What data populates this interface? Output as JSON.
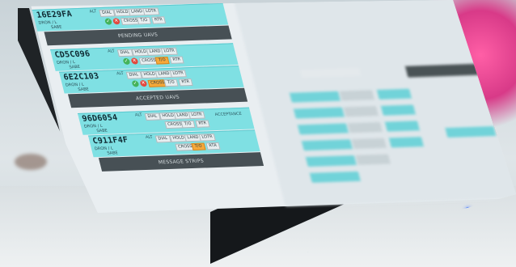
{
  "pending_strip": {
    "callsign": "16E29FA",
    "alt": "ALT",
    "line1": "DRON / L",
    "line2": "SABE",
    "buttons": [
      "DIAL",
      "HOLD",
      "LAND",
      "LOTR"
    ],
    "buttons2": [
      "CROSS",
      "T/O",
      "RTR"
    ]
  },
  "pending_label": "PENDING UAVS",
  "accepted": [
    {
      "callsign": "CD5C096",
      "alt": "ALT",
      "line1": "DRON / L",
      "line2": "SABE",
      "buttons": [
        "DIAL",
        "HOLD",
        "LAND",
        "LOTR"
      ],
      "buttons2": [
        "CROSS",
        "T/O",
        "RTR"
      ]
    },
    {
      "callsign": "6E2C103",
      "alt": "ALT",
      "line1": "DRON / L",
      "line2": "SABE",
      "buttons": [
        "DIAL",
        "HOLD",
        "LAND",
        "LOTR"
      ],
      "buttons2": [
        "CROSS",
        "T/O",
        "RTR"
      ]
    }
  ],
  "accepted_label": "ACCEPTED UAVS",
  "messages": [
    {
      "callsign": "96D6054",
      "alt": "ALT",
      "line1": "DRON / L",
      "line2": "SABE",
      "buttons": [
        "DIAL",
        "HOLD",
        "LAND",
        "LOTR"
      ],
      "buttons2": [
        "CROSS",
        "T/O",
        "RTR"
      ],
      "tag": "ACCEPTANCE"
    },
    {
      "callsign": "C911F4F",
      "alt": "ALT",
      "line1": "DRON / L",
      "line2": "SABE",
      "buttons": [
        "DIAL",
        "HOLD",
        "LAND",
        "LOTR"
      ],
      "buttons2": [
        "CROSS",
        "T/O",
        "RTR"
      ]
    }
  ],
  "message_label": "MESSAGE STRIPS",
  "colors": {
    "strip": "#7fe0e3",
    "bar": "#475055",
    "accept": "#44b35a",
    "reject": "#e2493f",
    "active_button": "#f6a93a",
    "power_led": "#3c72ff"
  },
  "icons": {
    "accept": "check-icon",
    "reject": "cross-icon",
    "taskbar": [
      "plus-icon",
      "sort-icon",
      "arrow-icon"
    ]
  }
}
